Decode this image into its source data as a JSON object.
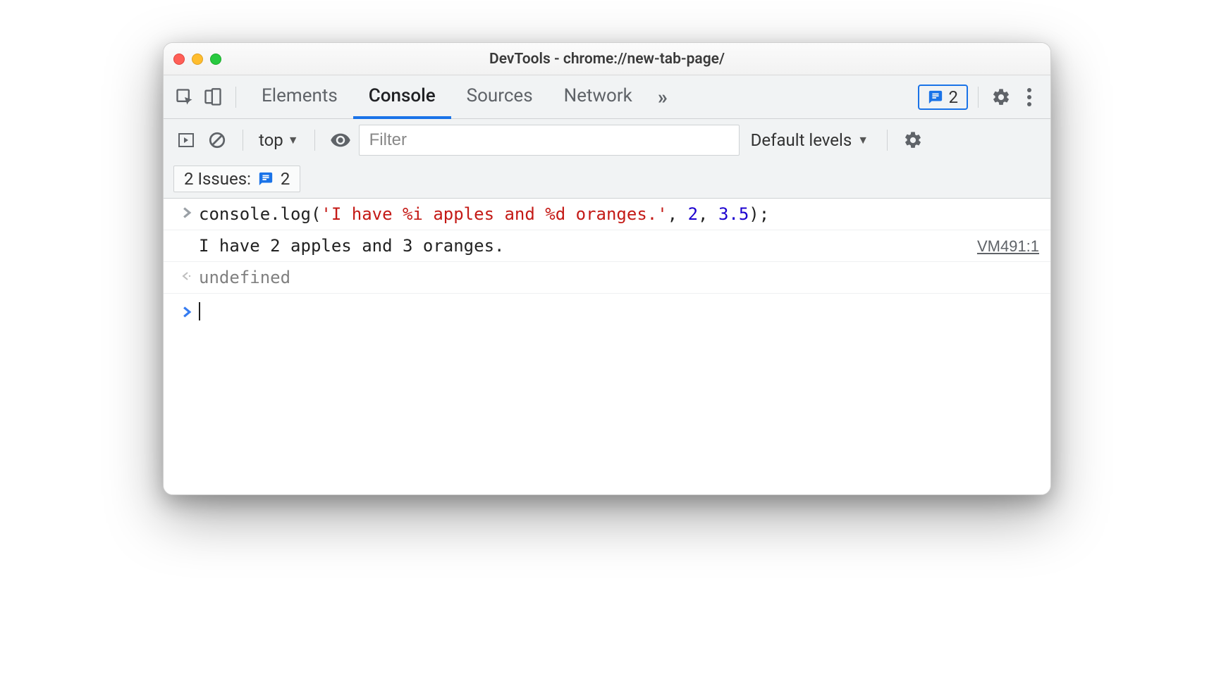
{
  "window": {
    "title": "DevTools - chrome://new-tab-page/"
  },
  "tabbar": {
    "tabs": [
      "Elements",
      "Console",
      "Sources",
      "Network"
    ],
    "active_index": 1,
    "issues_count": "2"
  },
  "toolbar": {
    "context": "top",
    "filter_placeholder": "Filter",
    "levels_label": "Default levels",
    "issues_label": "2 Issues:",
    "issues_count": "2"
  },
  "console": {
    "lines": [
      {
        "kind": "input",
        "tokens": [
          {
            "t": "plain",
            "v": "console.log("
          },
          {
            "t": "str",
            "v": "'I have %i apples and %d oranges.'"
          },
          {
            "t": "plain",
            "v": ", "
          },
          {
            "t": "num",
            "v": "2"
          },
          {
            "t": "plain",
            "v": ", "
          },
          {
            "t": "num",
            "v": "3.5"
          },
          {
            "t": "plain",
            "v": ");"
          }
        ]
      },
      {
        "kind": "output",
        "text": "I have 2 apples and 3 oranges.",
        "source": "VM491:1"
      },
      {
        "kind": "return",
        "text": "undefined"
      }
    ]
  }
}
